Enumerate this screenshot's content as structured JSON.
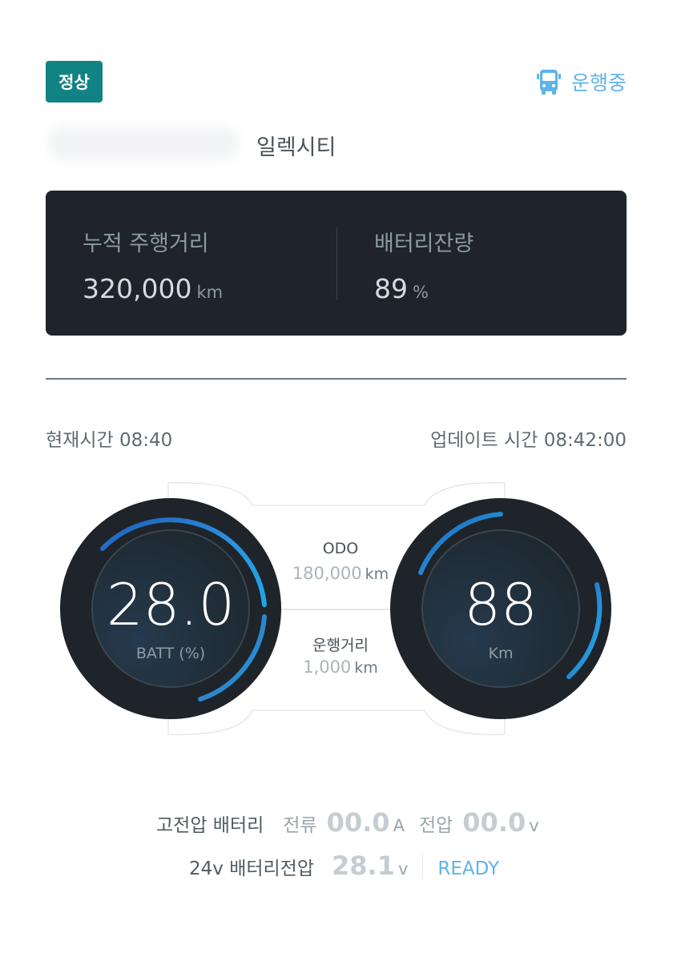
{
  "header": {
    "status": "정상",
    "operating": "운행중",
    "company": "일렉시티"
  },
  "summary": {
    "mileage_label": "누적 주행거리",
    "mileage_value": "320,000",
    "mileage_unit": "km",
    "battery_label": "배터리잔량",
    "battery_value": "89",
    "battery_unit": "%"
  },
  "times": {
    "current": "현재시간 08:40",
    "update": "업데이트 시간 08:42:00"
  },
  "gauges": {
    "battery_value": "28.0",
    "battery_label": "BATT (%)",
    "battery_fraction": 0.28,
    "speed_value": "88",
    "speed_label": "Km",
    "odo_label": "ODO",
    "odo_value": "180,000",
    "odo_unit": "km",
    "trip_label": "운행거리",
    "trip_value": "1,000",
    "trip_unit": "km"
  },
  "hv_battery": {
    "label": "고전압 배터리",
    "current_label": "전류",
    "current_value": "00.0",
    "current_unit": "A",
    "voltage_label": "전압",
    "voltage_value": "00.0",
    "voltage_unit": "v"
  },
  "lv_battery": {
    "label": "24v 배터리전압",
    "value": "28.1",
    "unit": "v",
    "state": "READY"
  },
  "colors": {
    "accent_teal": "#128384",
    "accent_blue": "#5fb3ea",
    "card_bg": "#1e2429"
  },
  "icons": [
    "bus-icon"
  ]
}
